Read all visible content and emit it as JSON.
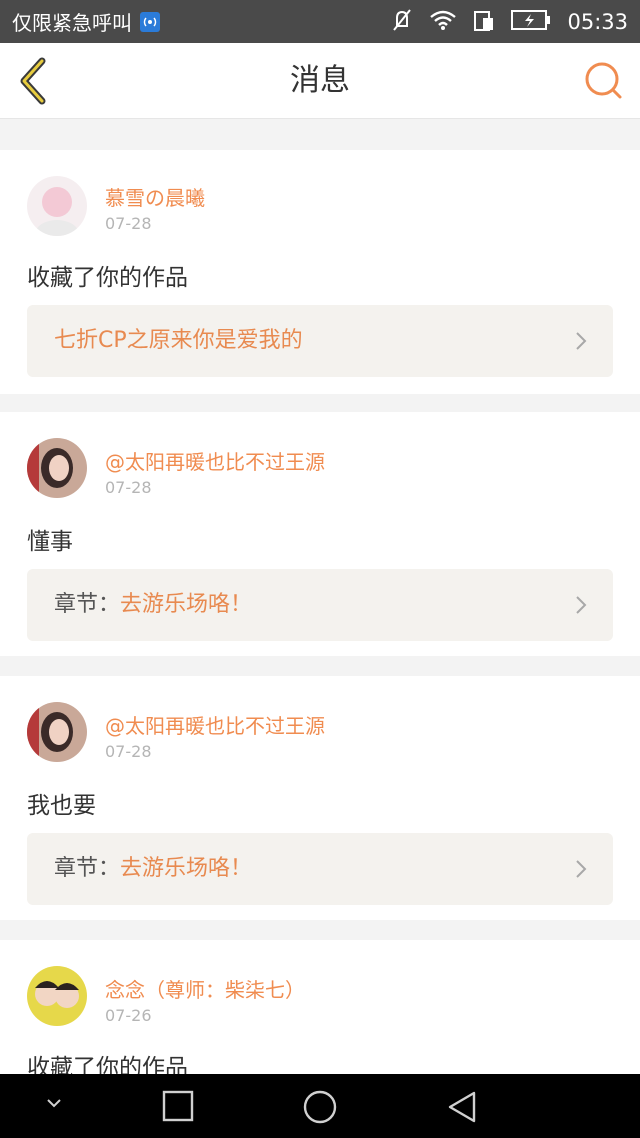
{
  "status_bar": {
    "carrier": "仅限紧急呼叫",
    "time": "05:33",
    "icons": [
      "sim-icon",
      "mute-icon",
      "wifi-icon",
      "data-icon",
      "battery-icon"
    ]
  },
  "header": {
    "title": "消息",
    "back_icon": "chevron-left-icon",
    "search_icon": "search-icon"
  },
  "messages": [
    {
      "username": "慕雪の晨曦",
      "date": "07-28",
      "text": "收藏了你的作品",
      "link_prefix": "",
      "link_text": "七折CP之原来你是爱我的"
    },
    {
      "username": "@太阳再暖也比不过王源",
      "date": "07-28",
      "text": "懂事",
      "link_prefix": "章节：",
      "link_text": "去游乐场咯！"
    },
    {
      "username": "@太阳再暖也比不过王源",
      "date": "07-28",
      "text": "我也要",
      "link_prefix": "章节：",
      "link_text": "去游乐场咯！"
    },
    {
      "username": "念念（尊师：柴柒七）",
      "date": "07-26",
      "text": "收藏了你的作品"
    }
  ],
  "colors": {
    "accent": "#f08c50",
    "status_bar": "#4a4a4a",
    "nav_bar": "#000000",
    "link_bg": "#f4f2ee"
  },
  "nav_bar": [
    "chevron-down-icon",
    "recent-apps-icon",
    "home-icon",
    "back-icon"
  ]
}
